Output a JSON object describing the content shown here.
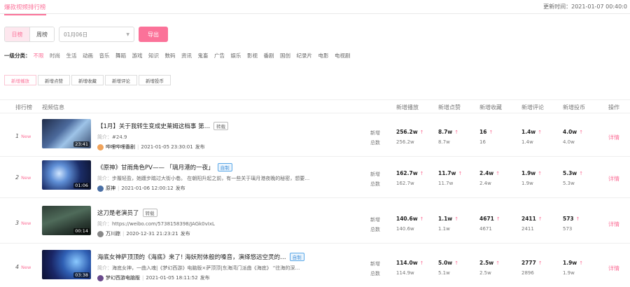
{
  "header": {
    "tab_label": "爆款视频排行榜",
    "update_time": "更新时间：2021-01-07 00:40:0"
  },
  "controls": {
    "daily_label": "日榜",
    "weekly_label": "周榜",
    "date_value": "01月06日",
    "export_label": "导出"
  },
  "categories": {
    "label": "一级分类：",
    "items": [
      "不限",
      "时尚",
      "生活",
      "动画",
      "音乐",
      "舞蹈",
      "游戏",
      "知识",
      "数码",
      "资讯",
      "鬼畜",
      "广告",
      "娱乐",
      "影视",
      "番剧",
      "国创",
      "纪录片",
      "电影",
      "电视剧"
    ]
  },
  "metric_tabs": [
    "新增播放",
    "新增点赞",
    "新增收藏",
    "新增评论",
    "新增投币"
  ],
  "table": {
    "headers": {
      "rank": "排行榜",
      "info": "视频信息",
      "play": "新增播放",
      "like": "新增点赞",
      "fav": "新增收藏",
      "comment": "新增评论",
      "coin": "新增投币",
      "action": "操作"
    },
    "new_label": "New",
    "add_label": "新增",
    "total_label": "总数",
    "detail_label": "详情",
    "desc_prefix": "简介：",
    "publish_suffix": "发布",
    "arrow": "↑",
    "rows": [
      {
        "rank": "1",
        "title": "【1月】关于我转生变成史莱姆这档事 第…",
        "tag": "转载",
        "tag_style": "gray",
        "desc": "#24.9",
        "uploader": "哔哩哔哩番剧",
        "published": "2021-01-05 23:30:01",
        "duration": "23:41",
        "play_new": "256.2w",
        "play_total": "256.2w",
        "like_new": "8.7w",
        "like_total": "8.7w",
        "fav_new": "16",
        "fav_total": "16",
        "comment_new": "1.4w",
        "comment_total": "1.4w",
        "coin_new": "4.0w",
        "coin_total": "4.0w"
      },
      {
        "rank": "2",
        "title": "《原神》甘雨角色PV—— 「璃月港的一夜」",
        "tag": "自制",
        "tag_style": "blue",
        "desc": "步履轻盈，她踱步踏过大街小巷。 在朝阳升起之前，有一些关于璃月港夜晚的秘密，想要…",
        "uploader": "原神",
        "published": "2021-01-06 12:00:12",
        "duration": "01:06",
        "play_new": "162.7w",
        "play_total": "162.7w",
        "like_new": "11.7w",
        "like_total": "11.7w",
        "fav_new": "2.4w",
        "fav_total": "2.4w",
        "comment_new": "1.9w",
        "comment_total": "1.9w",
        "coin_new": "5.3w",
        "coin_total": "5.3w"
      },
      {
        "rank": "3",
        "title": "这刀是老演员了",
        "tag": "转载",
        "tag_style": "gray",
        "desc": "https://weibo.com/5738158398/JAGk0vIxL",
        "uploader": "万川踪",
        "published": "2020-12-31 21:23:21",
        "duration": "00:14",
        "play_new": "140.6w",
        "play_total": "140.6w",
        "like_new": "1.1w",
        "like_total": "1.1w",
        "fav_new": "4671",
        "fav_total": "4671",
        "comment_new": "2411",
        "comment_total": "2411",
        "coin_new": "573",
        "coin_total": "573"
      },
      {
        "rank": "4",
        "title": "海底女神萨顶顶的《海底》来了! 海妖附体般的嗓音，演绎悠远空灵的…",
        "tag": "自制",
        "tag_style": "blue",
        "desc": "海底女神，一曲入魂|《梦幻西游》电脑版×萨顶顶|东海湾门派曲《海底》 “往海的深…",
        "uploader": "梦幻西游电脑版",
        "published": "2021-01-05 18:11:52",
        "duration": "03:38",
        "play_new": "114.0w",
        "play_total": "114.9w",
        "like_new": "5.0w",
        "like_total": "5.1w",
        "fav_new": "2.5w",
        "fav_total": "2.5w",
        "comment_new": "2777",
        "comment_total": "2896",
        "coin_new": "1.9w",
        "coin_total": "1.9w"
      }
    ]
  }
}
